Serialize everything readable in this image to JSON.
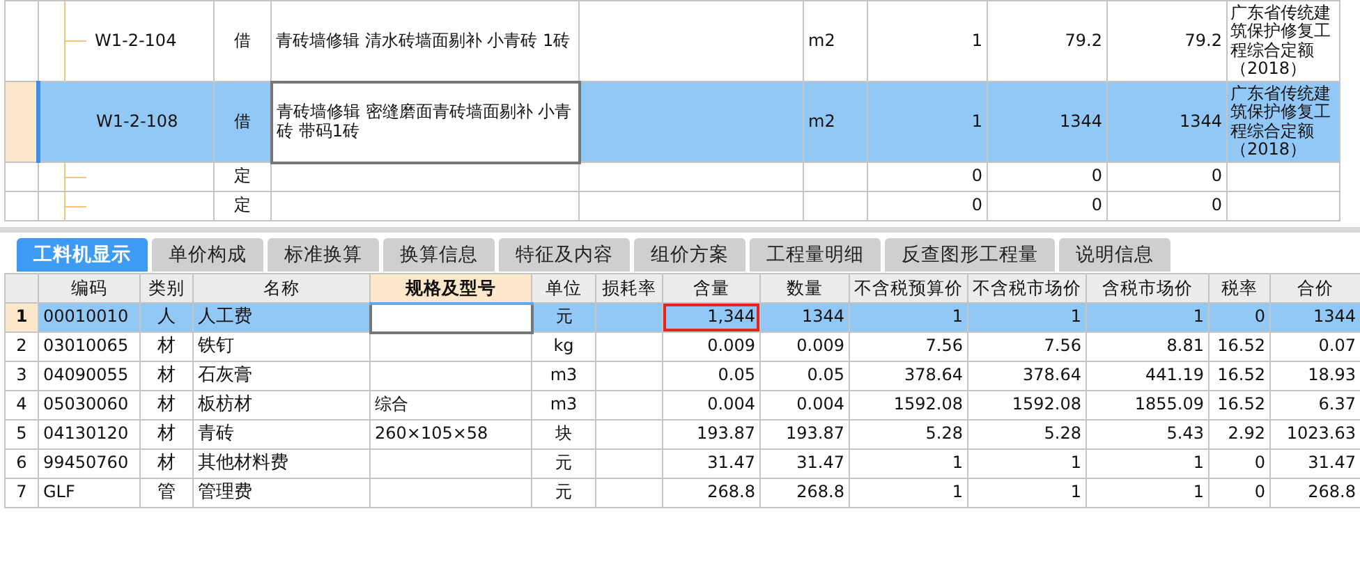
{
  "quota_table": {
    "rows": [
      {
        "code": "W1-2-104",
        "type": "借",
        "name": "青砖墙修辑 清水砖墙面剔补 小青砖 1砖",
        "unit": "m2",
        "quantity": "1",
        "unit_price": "79.2",
        "total": "79.2",
        "source": "广东省传统建筑保护修复工程综合定额（2018）",
        "selected": false,
        "editing": false
      },
      {
        "code": "W1-2-108",
        "type": "借",
        "name": "青砖墙修辑 密缝磨面青砖墙面剔补 小青砖 带码1砖",
        "unit": "m2",
        "quantity": "1",
        "unit_price": "1344",
        "total": "1344",
        "source": "广东省传统建筑保护修复工程综合定额（2018）",
        "selected": true,
        "editing": true
      },
      {
        "type": "定",
        "quantity": "0",
        "unit_price": "0",
        "total": "0",
        "selected": false,
        "editing": false
      },
      {
        "type": "定",
        "quantity": "0",
        "unit_price": "0",
        "total": "0",
        "selected": false,
        "editing": false
      }
    ]
  },
  "tabs": [
    {
      "label": "工料机显示",
      "selected": true
    },
    {
      "label": "单价构成",
      "selected": false
    },
    {
      "label": "标准换算",
      "selected": false
    },
    {
      "label": "换算信息",
      "selected": false
    },
    {
      "label": "特征及内容",
      "selected": false
    },
    {
      "label": "组价方案",
      "selected": false
    },
    {
      "label": "工程量明细",
      "selected": false
    },
    {
      "label": "反查图形工程量",
      "selected": false
    },
    {
      "label": "说明信息",
      "selected": false
    }
  ],
  "resources": {
    "columns": [
      {
        "label": "编码",
        "current": false
      },
      {
        "label": "类别",
        "current": false
      },
      {
        "label": "名称",
        "current": false
      },
      {
        "label": "规格及型号",
        "current": true
      },
      {
        "label": "单位",
        "current": false
      },
      {
        "label": "损耗率",
        "current": false
      },
      {
        "label": "含量",
        "current": false
      },
      {
        "label": "数量",
        "current": false
      },
      {
        "label": "不含税预算价",
        "current": false
      },
      {
        "label": "不含税市场价",
        "current": false
      },
      {
        "label": "含税市场价",
        "current": false
      },
      {
        "label": "税率",
        "current": false
      },
      {
        "label": "合价",
        "current": false
      }
    ],
    "rows": [
      {
        "number": "1",
        "code": "00010010",
        "category": "人",
        "name": "人工费",
        "unit": "元",
        "content": "1,344",
        "quantity": "1344",
        "budget_price": "1",
        "market_price": "1",
        "market_price_tax": "1",
        "tax_rate": "0",
        "total": "1344",
        "selected": true,
        "editing": true,
        "marked": true
      },
      {
        "number": "2",
        "code": "03010065",
        "category": "材",
        "name": "铁钉",
        "unit": "kg",
        "content": "0.009",
        "quantity": "0.009",
        "budget_price": "7.56",
        "market_price": "7.56",
        "market_price_tax": "8.81",
        "tax_rate": "16.52",
        "total": "0.07",
        "selected": false,
        "editing": false,
        "marked": false
      },
      {
        "number": "3",
        "code": "04090055",
        "category": "材",
        "name": "石灰膏",
        "unit": "m3",
        "content": "0.05",
        "quantity": "0.05",
        "budget_price": "378.64",
        "market_price": "378.64",
        "market_price_tax": "441.19",
        "tax_rate": "16.52",
        "total": "18.93",
        "selected": false,
        "editing": false,
        "marked": false
      },
      {
        "number": "4",
        "code": "05030060",
        "category": "材",
        "name": "板枋材",
        "spec": "综合",
        "unit": "m3",
        "content": "0.004",
        "quantity": "0.004",
        "budget_price": "1592.08",
        "market_price": "1592.08",
        "market_price_tax": "1855.09",
        "tax_rate": "16.52",
        "total": "6.37",
        "selected": false,
        "editing": false,
        "marked": false
      },
      {
        "number": "5",
        "code": "04130120",
        "category": "材",
        "name": "青砖",
        "spec": "260×105×58",
        "unit": "块",
        "content": "193.87",
        "quantity": "193.87",
        "budget_price": "5.28",
        "market_price": "5.28",
        "market_price_tax": "5.43",
        "tax_rate": "2.92",
        "total": "1023.63",
        "selected": false,
        "editing": false,
        "marked": false
      },
      {
        "number": "6",
        "code": "99450760",
        "category": "材",
        "name": "其他材料费",
        "unit": "元",
        "content": "31.47",
        "quantity": "31.47",
        "budget_price": "1",
        "market_price": "1",
        "market_price_tax": "1",
        "tax_rate": "0",
        "total": "31.47",
        "selected": false,
        "editing": false,
        "marked": false
      },
      {
        "number": "7",
        "code": "GLF",
        "category": "管",
        "name": "管理费",
        "unit": "元",
        "content": "268.8",
        "quantity": "268.8",
        "budget_price": "1",
        "market_price": "1",
        "market_price_tax": "1",
        "tax_rate": "0",
        "total": "268.8",
        "selected": false,
        "editing": false,
        "marked": false
      }
    ]
  }
}
